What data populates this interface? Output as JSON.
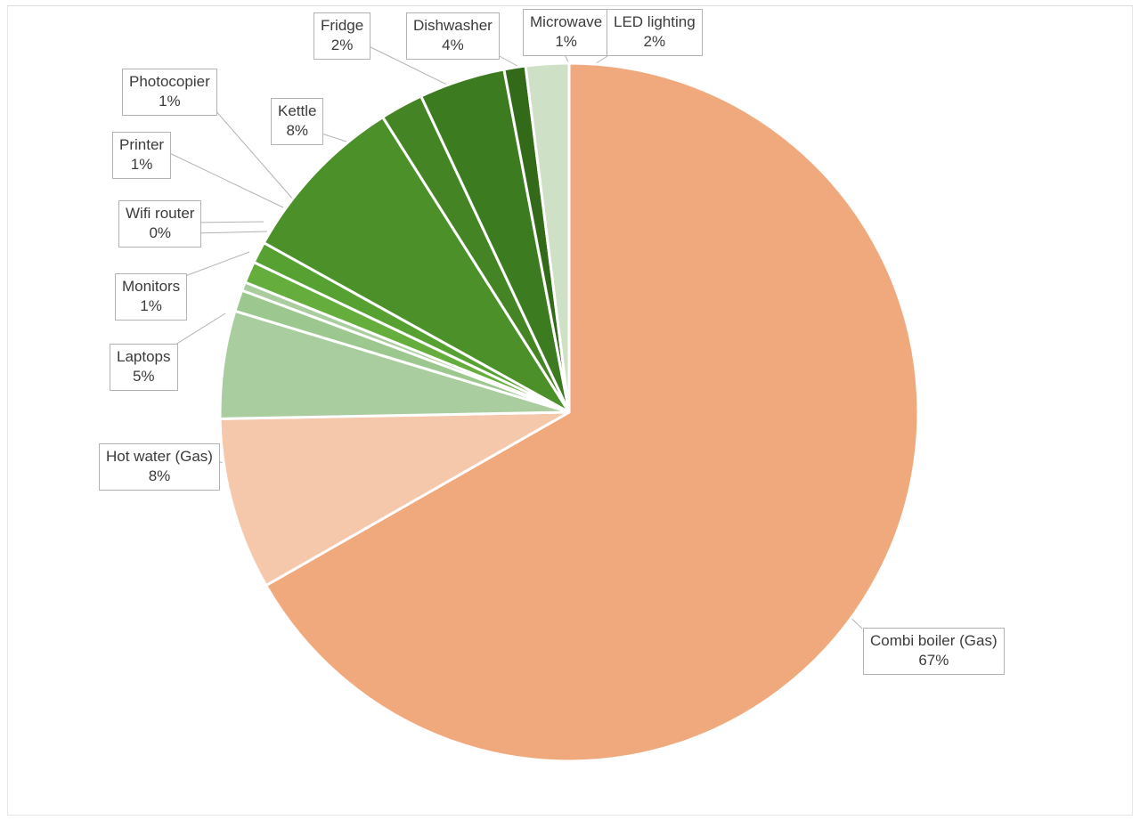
{
  "chart_data": {
    "type": "pie",
    "title": "",
    "subtitle": "",
    "xlabel": "",
    "ylabel": "",
    "legend_position": "none",
    "grid": false,
    "label_format": "category + percentage",
    "start_angle_deg": 0,
    "direction": "clockwise",
    "categories": [
      "Combi boiler (Gas)",
      "Hot water (Gas)",
      "Laptops",
      "Monitors",
      "Wifi router",
      "Printer",
      "Photocopier",
      "Kettle",
      "Fridge",
      "Dishwasher",
      "Microwave",
      "LED lighting"
    ],
    "values": [
      67,
      8,
      5,
      1,
      0.4,
      1,
      1,
      8,
      2,
      4,
      1,
      2
    ],
    "percent_labels": [
      "67%",
      "8%",
      "5%",
      "1%",
      "0%",
      "1%",
      "1%",
      "8%",
      "2%",
      "4%",
      "1%",
      "2%"
    ],
    "colors": [
      "#f0a97d",
      "#f5c7ab",
      "#aacd9f",
      "#8dbd80",
      "#cee0c6",
      "#5aa832",
      "#4b9029",
      "#4b9029",
      "#53a02c",
      "#3c7a20",
      "#2f6b17",
      "#cee0c6"
    ],
    "slice_gap_color": "#ffffff",
    "slices": [
      {
        "label": "Combi boiler (Gas)",
        "percent_label": "67%",
        "value": 67,
        "color": "#f0a97d"
      },
      {
        "label": "Hot water (Gas)",
        "percent_label": "8%",
        "value": 8,
        "color": "#f5c7ab"
      },
      {
        "label": "Laptops",
        "percent_label": "5%",
        "value": 5,
        "color": "#aacd9f"
      },
      {
        "label": "Monitors",
        "percent_label": "1%",
        "value": 1,
        "color": "#9cc78f"
      },
      {
        "label": "Wifi router",
        "percent_label": "0%",
        "value": 0.4,
        "color": "#aacd9f"
      },
      {
        "label": "Printer",
        "percent_label": "1%",
        "value": 1,
        "color": "#65ad3c"
      },
      {
        "label": "Photocopier",
        "percent_label": "1%",
        "value": 1,
        "color": "#57a133"
      },
      {
        "label": "Kettle",
        "percent_label": "8%",
        "value": 8,
        "color": "#4b9029"
      },
      {
        "label": "Fridge",
        "percent_label": "2%",
        "value": 2,
        "color": "#448425"
      },
      {
        "label": "Dishwasher",
        "percent_label": "4%",
        "value": 4,
        "color": "#3d7b21"
      },
      {
        "label": "Microwave",
        "percent_label": "1%",
        "value": 1,
        "color": "#336a1a"
      },
      {
        "label": "LED lighting",
        "percent_label": "2%",
        "value": 2,
        "color": "#cee0c6"
      }
    ]
  },
  "labels": {
    "combi_boiler": {
      "category": "Combi boiler (Gas)",
      "percent": "67%"
    },
    "hot_water": {
      "category": "Hot water (Gas)",
      "percent": "8%"
    },
    "laptops": {
      "category": "Laptops",
      "percent": "5%"
    },
    "monitors": {
      "category": "Monitors",
      "percent": "1%"
    },
    "wifi_router": {
      "category": "Wifi router",
      "percent": "0%"
    },
    "printer": {
      "category": "Printer",
      "percent": "1%"
    },
    "photocopier": {
      "category": "Photocopier",
      "percent": "1%"
    },
    "kettle": {
      "category": "Kettle",
      "percent": "8%"
    },
    "fridge": {
      "category": "Fridge",
      "percent": "2%"
    },
    "dishwasher": {
      "category": "Dishwasher",
      "percent": "4%"
    },
    "microwave": {
      "category": "Microwave",
      "percent": "1%"
    },
    "led_lighting": {
      "category": "LED lighting",
      "percent": "2%"
    }
  }
}
